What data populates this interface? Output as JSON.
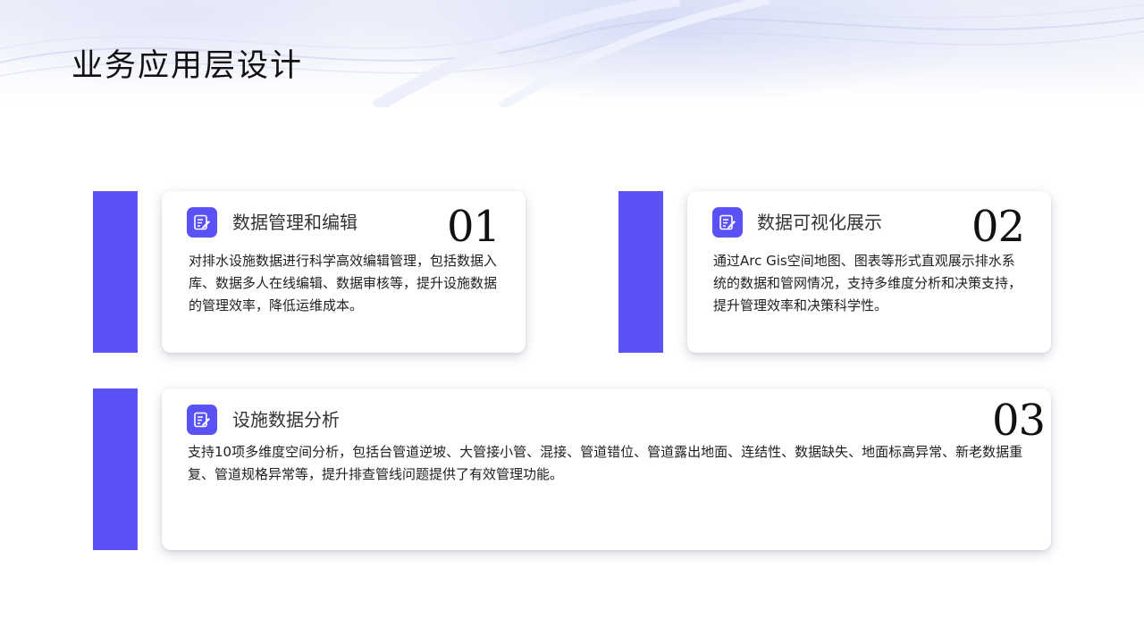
{
  "page": {
    "title": "业务应用层设计",
    "accent_color": "#5b52f5"
  },
  "cards": [
    {
      "icon": "edit-note-icon",
      "title": "数据管理和编辑",
      "number": "01",
      "body": "对排水设施数据进行科学高效编辑管理，包括数据入库、数据多人在线编辑、数据审核等，提升设施数据的管理效率，降低运维成本。"
    },
    {
      "icon": "edit-note-icon",
      "title": "数据可视化展示",
      "number": "02",
      "body": "通过Arc Gis空间地图、图表等形式直观展示排水系统的数据和管网情况，支持多维度分析和决策支持，提升管理效率和决策科学性。"
    },
    {
      "icon": "edit-note-icon",
      "title": "设施数据分析",
      "number": "03",
      "body": "支持10项多维度空间分析，包括台管道逆坡、大管接小管、混接、管道错位、管道露出地面、连结性、数据缺失、地面标高异常、新老数据重复、管道规格异常等，提升排查管线问题提供了有效管理功能。"
    }
  ]
}
